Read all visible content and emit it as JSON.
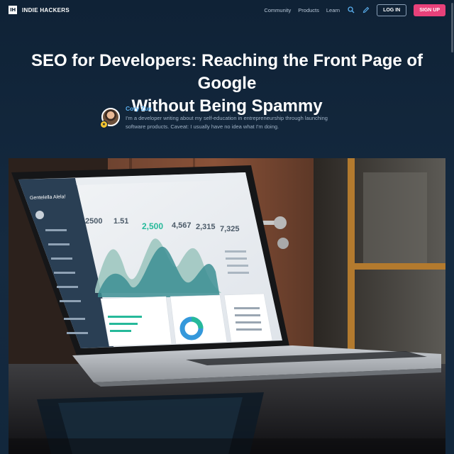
{
  "nav": {
    "logo_mark": "IH",
    "brand": "INDIE HACKERS",
    "links": [
      "Community",
      "Products",
      "Learn"
    ],
    "login_label": "LOG IN",
    "signup_label": "SIGN UP",
    "icons": [
      "search-icon",
      "pencil-icon"
    ]
  },
  "article": {
    "title_line1": "SEO for Developers: Reaching the Front Page of Google",
    "title_line2": "Without Being Spammy"
  },
  "author": {
    "name": "Cory Zue",
    "bio_line1": "I'm a developer writing about my self-education in entrepreneurship through launching",
    "bio_line2": "software products. Caveat: I usually have no idea what I'm doing."
  },
  "hero_screen": {
    "brand": "Gentelella Alela!",
    "stats": [
      "2500",
      "1.51",
      "2,500",
      "4,567",
      "2,315",
      "7,325"
    ],
    "colors": {
      "accent": "#26b99a",
      "wave1": "#9ec6c0",
      "wave2": "#3c8f93",
      "sidebar": "#2a3f54"
    }
  }
}
